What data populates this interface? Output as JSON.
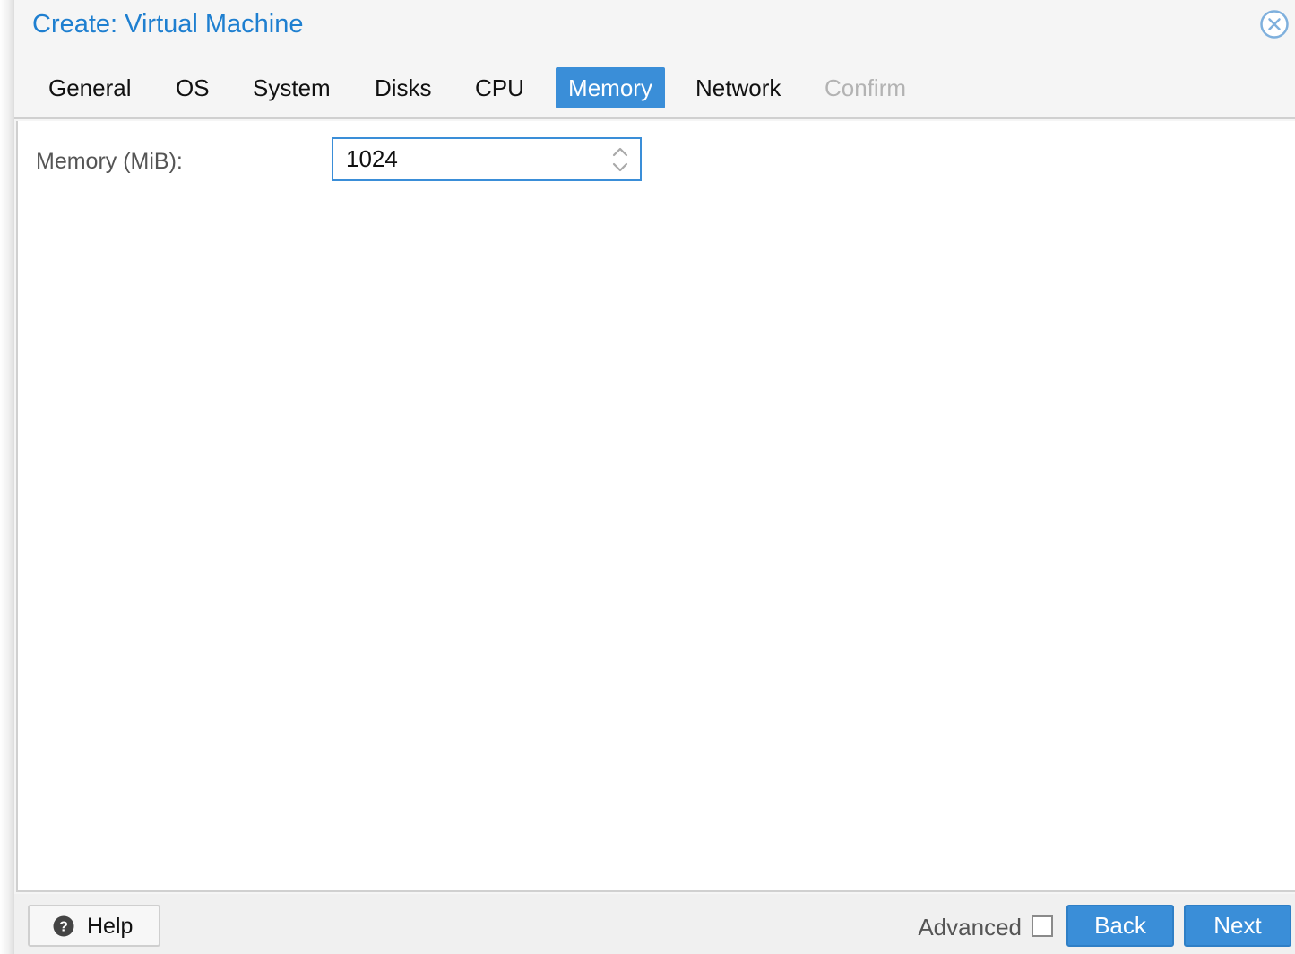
{
  "window": {
    "title": "Create: Virtual Machine"
  },
  "tabs": [
    {
      "label": "General",
      "state": "normal"
    },
    {
      "label": "OS",
      "state": "normal"
    },
    {
      "label": "System",
      "state": "normal"
    },
    {
      "label": "Disks",
      "state": "normal"
    },
    {
      "label": "CPU",
      "state": "normal"
    },
    {
      "label": "Memory",
      "state": "active"
    },
    {
      "label": "Network",
      "state": "normal"
    },
    {
      "label": "Confirm",
      "state": "disabled"
    }
  ],
  "form": {
    "memory_label": "Memory (MiB):",
    "memory_value": "1024"
  },
  "footer": {
    "help_label": "Help",
    "advanced_label": "Advanced",
    "advanced_checked": false,
    "back_label": "Back",
    "next_label": "Next"
  },
  "colors": {
    "accent": "#3a8ed8",
    "title": "#1e7fd0",
    "disabled_text": "#b3b3b3"
  },
  "icons": {
    "close": "close-circle-icon",
    "help": "question-circle-icon",
    "spinner": "spinner-arrows-icon"
  }
}
